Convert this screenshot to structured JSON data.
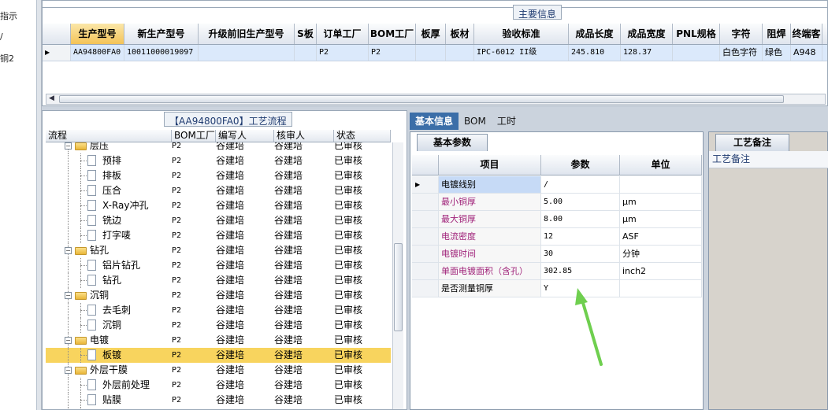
{
  "sidebar": {
    "line1": "指示",
    "line2": "/",
    "line3": "铜2"
  },
  "main_info": {
    "title": "主要信息",
    "columns": [
      "生产型号",
      "新生产型号",
      "升级前旧生产型号",
      "S板",
      "订单工厂",
      "BOM工厂",
      "板厚",
      "板材",
      "验收标准",
      "成品长度",
      "成品宽度",
      "PNL规格",
      "字符",
      "阻焊",
      "终端客"
    ],
    "row": [
      "AA94800FA0",
      "10011000019097",
      "",
      "",
      "P2",
      "P2",
      "",
      "",
      "IPC-6012 II级",
      "245.810",
      "128.37",
      "",
      "白色字符",
      "绿色",
      "A948"
    ]
  },
  "process": {
    "title": "【AA94800FA0】工艺流程",
    "columns": [
      "流程",
      "BOM工厂",
      "编写人",
      "核审人",
      "状态"
    ],
    "rows": [
      {
        "label": "层压",
        "level": 1,
        "folder": true,
        "factory": "P2",
        "writer": "谷建培",
        "reviewer": "谷建培",
        "status": "已审核"
      },
      {
        "label": "预排",
        "level": 2,
        "factory": "P2",
        "writer": "谷建培",
        "reviewer": "谷建培",
        "status": "已审核"
      },
      {
        "label": "排板",
        "level": 2,
        "factory": "P2",
        "writer": "谷建培",
        "reviewer": "谷建培",
        "status": "已审核"
      },
      {
        "label": "压合",
        "level": 2,
        "factory": "P2",
        "writer": "谷建培",
        "reviewer": "谷建培",
        "status": "已审核"
      },
      {
        "label": "X-Ray冲孔",
        "level": 2,
        "factory": "P2",
        "writer": "谷建培",
        "reviewer": "谷建培",
        "status": "已审核"
      },
      {
        "label": "铣边",
        "level": 2,
        "factory": "P2",
        "writer": "谷建培",
        "reviewer": "谷建培",
        "status": "已审核"
      },
      {
        "label": "打字唛",
        "level": 2,
        "factory": "P2",
        "writer": "谷建培",
        "reviewer": "谷建培",
        "status": "已审核"
      },
      {
        "label": "钻孔",
        "level": 1,
        "folder": true,
        "factory": "P2",
        "writer": "谷建培",
        "reviewer": "谷建培",
        "status": "已审核"
      },
      {
        "label": "铝片钻孔",
        "level": 2,
        "factory": "P2",
        "writer": "谷建培",
        "reviewer": "谷建培",
        "status": "已审核"
      },
      {
        "label": "钻孔",
        "level": 2,
        "factory": "P2",
        "writer": "谷建培",
        "reviewer": "谷建培",
        "status": "已审核"
      },
      {
        "label": "沉铜",
        "level": 1,
        "folder": true,
        "factory": "P2",
        "writer": "谷建培",
        "reviewer": "谷建培",
        "status": "已审核"
      },
      {
        "label": "去毛刺",
        "level": 2,
        "factory": "P2",
        "writer": "谷建培",
        "reviewer": "谷建培",
        "status": "已审核"
      },
      {
        "label": "沉铜",
        "level": 2,
        "factory": "P2",
        "writer": "谷建培",
        "reviewer": "谷建培",
        "status": "已审核"
      },
      {
        "label": "电镀",
        "level": 1,
        "folder": true,
        "factory": "P2",
        "writer": "谷建培",
        "reviewer": "谷建培",
        "status": "已审核"
      },
      {
        "label": "板镀",
        "level": 2,
        "selected": true,
        "factory": "P2",
        "writer": "谷建培",
        "reviewer": "谷建培",
        "status": "已审核"
      },
      {
        "label": "外层干膜",
        "level": 1,
        "folder": true,
        "factory": "P2",
        "writer": "谷建培",
        "reviewer": "谷建培",
        "status": "已审核"
      },
      {
        "label": "外层前处理",
        "level": 2,
        "factory": "P2",
        "writer": "谷建培",
        "reviewer": "谷建培",
        "status": "已审核"
      },
      {
        "label": "贴膜",
        "level": 2,
        "factory": "P2",
        "writer": "谷建培",
        "reviewer": "谷建培",
        "status": "已审核"
      },
      {
        "label": "",
        "level": 2,
        "factory": "",
        "writer": "",
        "reviewer": "",
        "status": ""
      }
    ]
  },
  "tabs": [
    "基本信息",
    "BOM",
    "工时"
  ],
  "basic_params": {
    "title": "基本参数",
    "columns": [
      "项目",
      "参数",
      "单位"
    ],
    "rows": [
      {
        "item": "电镀线别",
        "param": "/",
        "unit": "",
        "current": true
      },
      {
        "item": "最小铜厚",
        "param": "5.00",
        "unit": "μm"
      },
      {
        "item": "最大铜厚",
        "param": "8.00",
        "unit": "μm"
      },
      {
        "item": "电流密度",
        "param": "12",
        "unit": "ASF"
      },
      {
        "item": "电镀时间",
        "param": "30",
        "unit": "分钟"
      },
      {
        "item": "单面电镀面积（含孔）",
        "param": "302.85",
        "unit": "inch2"
      },
      {
        "item": "是否测量铜厚",
        "param": "Y",
        "unit": "",
        "plain": true
      }
    ]
  },
  "remarks": {
    "tab": "工艺备注",
    "label": "工艺备注"
  },
  "colors": {
    "selection": "#f8d45e",
    "accent_tab": "#3b6ea8",
    "item_text": "#a0237a",
    "annotation_arrow": "#6fcf4f"
  }
}
